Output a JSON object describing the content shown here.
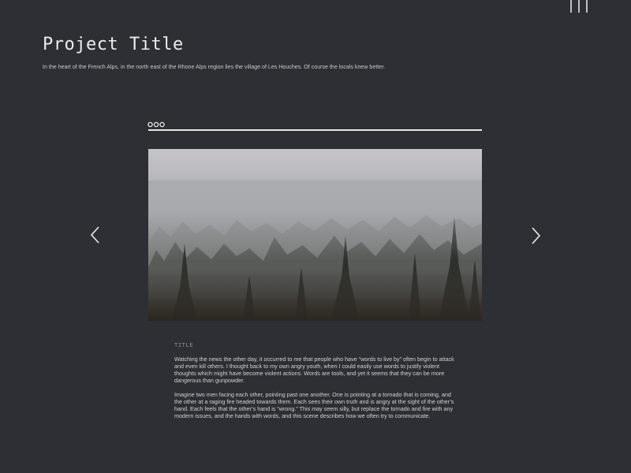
{
  "header": {
    "menu_icon": "hamburger-menu-icon",
    "title": "Project Title",
    "subtitle": "In the heart of the French Alps, in the north east of the Rhone Alps region lies the village of Les Houches. Of course the locals knew better."
  },
  "slider": {
    "window_dots_icon": "window-dots-icon",
    "image_icon": "misty-forest-photo",
    "prev_icon": "chevron-left-icon",
    "next_icon": "chevron-right-icon"
  },
  "content": {
    "caption": "TITLE",
    "paragraphs": [
      "Watching the news the other day, it occurred to me that people who have “words to live by” often begin to attack and even kill others. I thought back to my own angry youth, when I could easily use words to justify violent thoughts which might have become violent actions. Words are tools, and yet it seems that they can be more dangerous than gunpowder.",
      "Imagine two men facing each other, pointing past one another. One is pointing at a tornado that is coming, and the other at a raging fire headed towards them. Each sees their own truth and is angry at the sight of the other’s hand. Each feels that the other’s hand is “wrong.” This may seem silly, but replace the tornado and fire with any modern issues, and the hands with words, and this scene describes how we often try to communicate."
    ]
  },
  "colors": {
    "background": "#2e2f34",
    "foreground": "#ececee",
    "muted": "#8e8f95"
  }
}
